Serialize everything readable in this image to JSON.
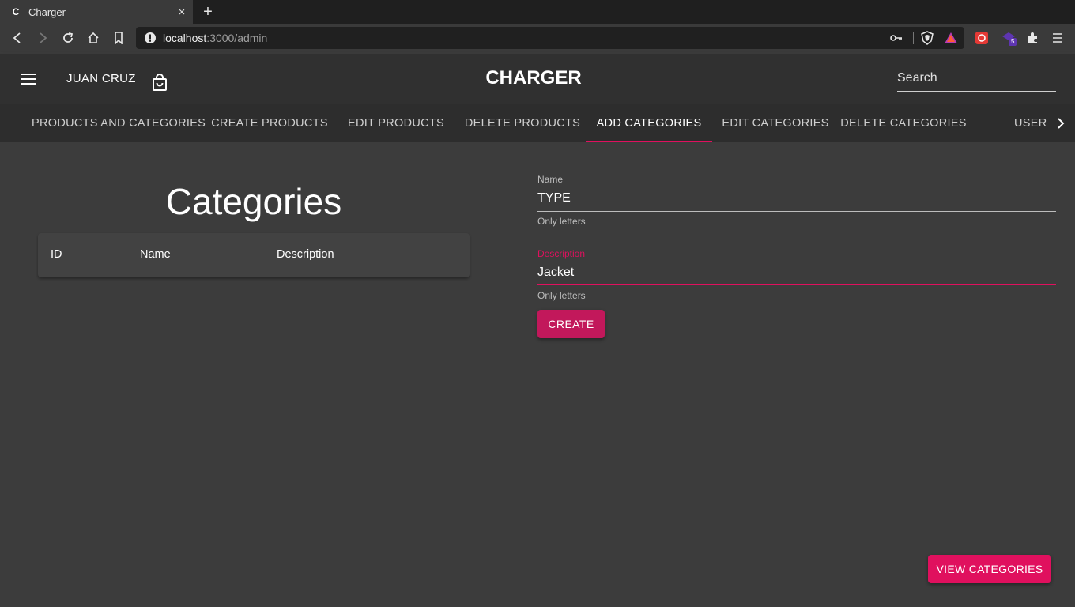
{
  "browser": {
    "tab_title": "Charger",
    "tab_favicon": "C",
    "new_tab": "+",
    "close": "×",
    "url_host": "localhost",
    "url_path": ":3000/admin"
  },
  "header": {
    "user_name": "JUAN CRUZ",
    "brand": "CHARGER",
    "search_placeholder": "Search"
  },
  "tabs": [
    {
      "label": "PRODUCTS AND CATEGORIES"
    },
    {
      "label": "CREATE PRODUCTS"
    },
    {
      "label": "EDIT PRODUCTS"
    },
    {
      "label": "DELETE PRODUCTS"
    },
    {
      "label": "ADD CATEGORIES",
      "active": true
    },
    {
      "label": "EDIT CATEGORIES"
    },
    {
      "label": "DELETE CATEGORIES"
    },
    {
      "label": "USER"
    }
  ],
  "categories": {
    "title": "Categories",
    "columns": [
      "ID",
      "Name",
      "Description"
    ]
  },
  "form": {
    "name_label": "Name",
    "name_value": "TYPE",
    "name_helper": "Only letters",
    "description_label": "Description",
    "description_value": "Jacket",
    "description_helper": "Only letters",
    "create_label": "CREATE"
  },
  "view_categories_label": "VIEW CATEGORIES",
  "colors": {
    "accent": "#e0105e",
    "background": "#3c3c3c",
    "header": "#303030"
  },
  "extensions": {
    "badge_count": "5"
  }
}
